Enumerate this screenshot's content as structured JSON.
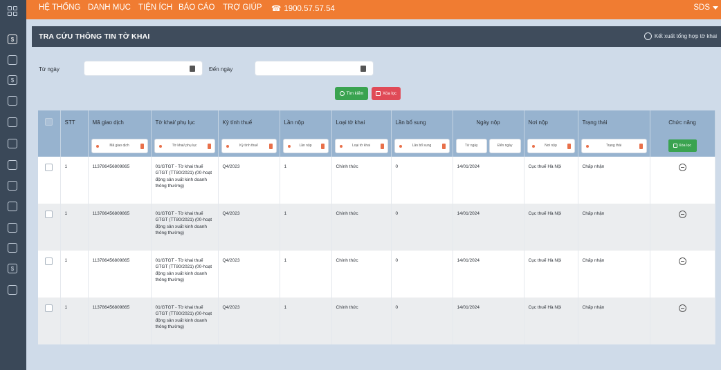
{
  "topbar": {
    "menu": [
      "HỆ THỐNG",
      "DANH MỤC",
      "TIỆN ÍCH",
      "BÁO CÁO",
      "TRỢ GIÚP"
    ],
    "phone": "1900.57.57.54",
    "user": "SDS"
  },
  "panel": {
    "title": "TRA CỨU THÔNG TIN TỜ KHAI",
    "export_label": "Kết xuất tổng hợp tờ khai"
  },
  "filter": {
    "from_label": "Từ ngày",
    "to_label": "Đến ngày",
    "search_button": "Tìm kiếm",
    "clear_button": "Xóa lọc"
  },
  "table": {
    "headers": [
      "STT",
      "Mã giao dịch",
      "Tờ khai/ phụ lục",
      "Kỳ tính thuế",
      "Lần nộp",
      "Loại tờ khai",
      "Lần bổ sung",
      "Ngày nộp",
      "Nơi nộp",
      "Trạng thái",
      "Chức năng"
    ],
    "filters": {
      "ma_giao_dich": "Mã giao dịch",
      "to_khai": "Tờ khai/ phụ lục",
      "ky_tinh_thue": "Kỳ tính thuế",
      "lan_nop": "Lần nộp",
      "loai_to_khai": "Loại tờ khai",
      "lan_bo_sung": "Lần bổ sung",
      "tu_ngay": "Từ ngày",
      "den_ngay": "Đến ngày",
      "noi_nop": "Nơi nộp",
      "trang_thai": "Trạng thái",
      "action_button": "Xóa lọc"
    },
    "rows": [
      {
        "stt": "1",
        "ma": "113786456809865",
        "to_khai": "01/GTGT - Tờ khai thuế GTGT (TT80/2021) (00-hoạt động sản xuất kinh doanh thông thường)",
        "ky": "Q4/2023",
        "lan_nop": "1",
        "loai": "Chính thức",
        "bo_sung": "0",
        "ngay": "14/01/2024",
        "noi": "Cục thuế Hà Nội",
        "trang_thai": "Chấp nhận"
      },
      {
        "stt": "1",
        "ma": "113786456809865",
        "to_khai": "01/GTGT - Tờ khai thuế GTGT (TT80/2021) (00-hoạt động sản xuất kinh doanh thông thường)",
        "ky": "Q4/2023",
        "lan_nop": "1",
        "loai": "Chính thức",
        "bo_sung": "0",
        "ngay": "14/01/2024",
        "noi": "Cục thuế Hà Nội",
        "trang_thai": "Chấp nhận"
      },
      {
        "stt": "1",
        "ma": "113786456809865",
        "to_khai": "01/GTGT - Tờ khai thuế GTGT (TT80/2021) (00-hoạt động sản xuất kinh doanh thông thường)",
        "ky": "Q4/2023",
        "lan_nop": "1",
        "loai": "Chính thức",
        "bo_sung": "0",
        "ngay": "14/01/2024",
        "noi": "Cục thuế Hà Nội",
        "trang_thai": "Chấp nhận"
      },
      {
        "stt": "1",
        "ma": "113786456809865",
        "to_khai": "01/GTGT - Tờ khai thuế GTGT (TT80/2021) (00-hoạt động sản xuất kinh doanh thông thường)",
        "ky": "Q4/2023",
        "lan_nop": "1",
        "loai": "Chính thức",
        "bo_sung": "0",
        "ngay": "14/01/2024",
        "noi": "Cục thuế Hà Nội",
        "trang_thai": "Chấp nhận"
      }
    ]
  },
  "colors": {
    "topbar": "#f07c32",
    "sidebar": "#3a4858",
    "panel_header": "#3f4c5c",
    "table_header": "#97b3cf",
    "green_button": "#3aa350",
    "red_button": "#e04a57",
    "background": "#cfdbe9"
  }
}
